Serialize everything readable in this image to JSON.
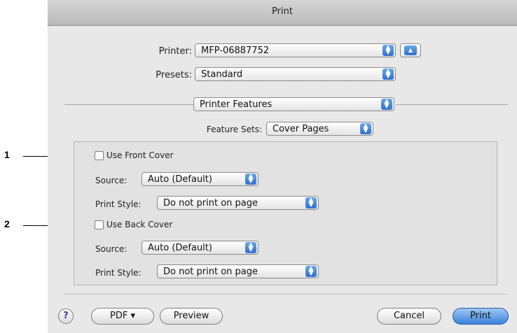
{
  "dialog": {
    "title": "Print",
    "printer": {
      "label": "Printer:",
      "value": "MFP-06887752"
    },
    "presets": {
      "label": "Presets:",
      "value": "Standard"
    },
    "section": {
      "value": "Printer Features"
    },
    "feature_sets": {
      "label": "Feature Sets:",
      "value": "Cover Pages"
    },
    "front_cover": {
      "checkbox_label": "Use Front Cover",
      "source_label": "Source:",
      "source_value": "Auto (Default)",
      "style_label": "Print Style:",
      "style_value": "Do not print on page"
    },
    "back_cover": {
      "checkbox_label": "Use Back Cover",
      "source_label": "Source:",
      "source_value": "Auto (Default)",
      "style_label": "Print Style:",
      "style_value": "Do not print on page"
    },
    "footer": {
      "help": "?",
      "pdf": "PDF ▾",
      "preview": "Preview",
      "cancel": "Cancel",
      "print": "Print"
    }
  },
  "callouts": [
    "1",
    "2"
  ],
  "colors": {
    "accent": "#3b82dc",
    "window": "#e8e8e8"
  },
  "icons": {
    "popup": "updown-arrows-icon",
    "disclosure": "triangle-up-icon"
  }
}
